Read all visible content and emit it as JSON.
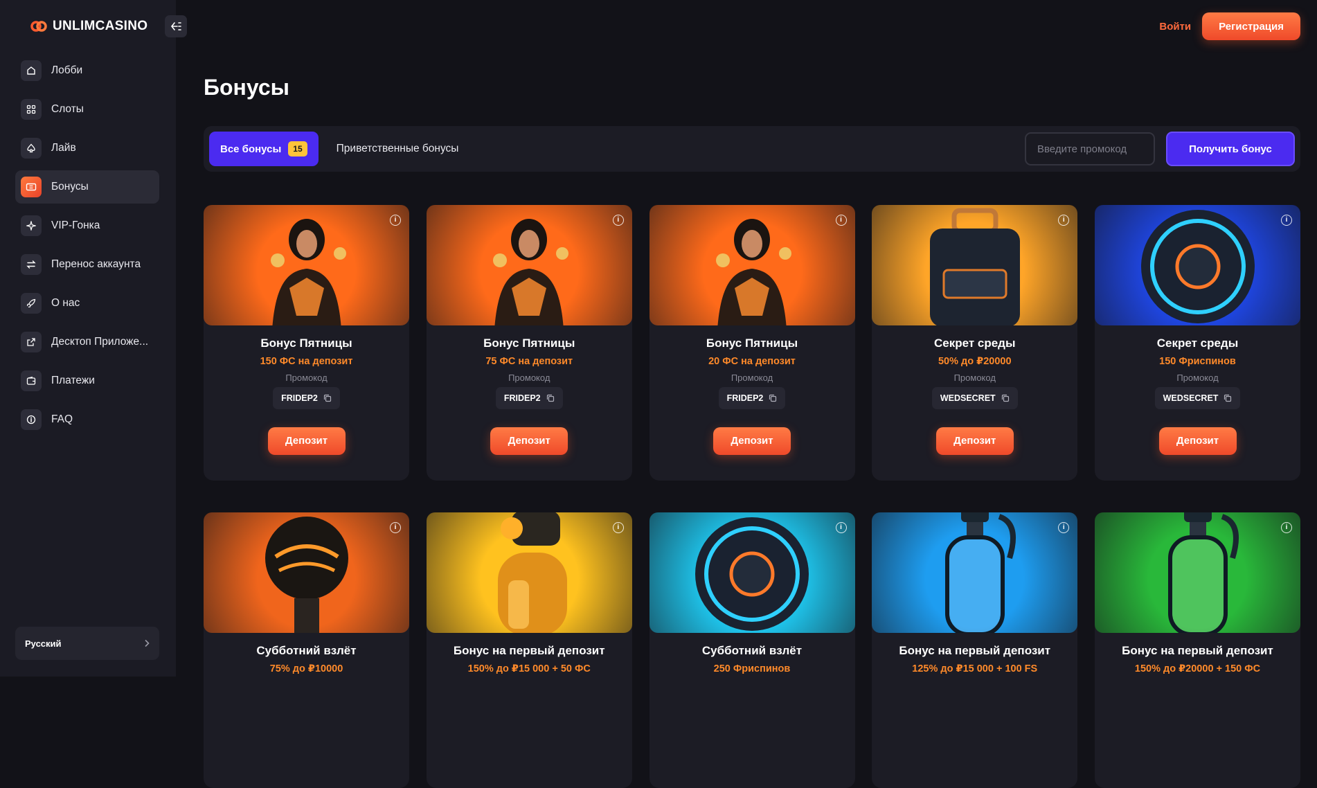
{
  "brand": {
    "name": "UNLIMCASINO"
  },
  "header": {
    "login_label": "Войти",
    "register_label": "Регистрация"
  },
  "sidebar": {
    "items": [
      {
        "label": "Лобби",
        "icon": "home-icon"
      },
      {
        "label": "Слоты",
        "icon": "grid-icon"
      },
      {
        "label": "Лайв",
        "icon": "spade-icon"
      },
      {
        "label": "Бонусы",
        "icon": "ticket-icon",
        "active": true
      },
      {
        "label": "VIP-Гонка",
        "icon": "sparkle-icon"
      },
      {
        "label": "Перенос аккаунта",
        "icon": "transfer-icon"
      },
      {
        "label": "О нас",
        "icon": "rocket-icon"
      },
      {
        "label": "Десктоп Приложе...",
        "icon": "external-link-icon"
      },
      {
        "label": "Платежи",
        "icon": "wallet-icon"
      },
      {
        "label": "FAQ",
        "icon": "info-icon"
      }
    ],
    "language": "Русский"
  },
  "page": {
    "title": "Бонусы"
  },
  "filters": {
    "all_label": "Все бонусы",
    "all_count": "15",
    "welcome_label": "Приветственные бонусы",
    "promo_placeholder": "Введите промокод",
    "get_bonus_label": "Получить бонус"
  },
  "common": {
    "promo_label": "Промокод",
    "deposit_label": "Депозит"
  },
  "cards": [
    {
      "title": "Бонус Пятницы",
      "subtitle": "150 ФС на депозит",
      "code": "FRIDEP2",
      "theme": "#ff6a1a"
    },
    {
      "title": "Бонус Пятницы",
      "subtitle": "75 ФС на депозит",
      "code": "FRIDEP2",
      "theme": "#ff6a1a"
    },
    {
      "title": "Бонус Пятницы",
      "subtitle": "20 ФС на депозит",
      "code": "FRIDEP2",
      "theme": "#ff6a1a"
    },
    {
      "title": "Секрет среды",
      "subtitle": "50% до ₽20000",
      "code": "WEDSECRET",
      "theme": "#ffa528"
    },
    {
      "title": "Секрет среды",
      "subtitle": "150 Фриспинов",
      "code": "WEDSECRET",
      "theme": "#1f47e6"
    },
    {
      "title": "Субботний взлёт",
      "subtitle": "75% до ₽10000",
      "theme": "#f0651c"
    },
    {
      "title": "Бонус на первый депозит",
      "subtitle": "150% до ₽15 000 + 50 ФС",
      "theme": "#ffc21f"
    },
    {
      "title": "Субботний взлёт",
      "subtitle": "250 Фриспинов",
      "theme": "#1fc8f0"
    },
    {
      "title": "Бонус на первый депозит",
      "subtitle": "125% до ₽15 000 + 100 FS",
      "theme": "#1e9df0"
    },
    {
      "title": "Бонус на первый депозит",
      "subtitle": "150% до ₽20000 + 150 ФС",
      "theme": "#29b83a"
    }
  ]
}
